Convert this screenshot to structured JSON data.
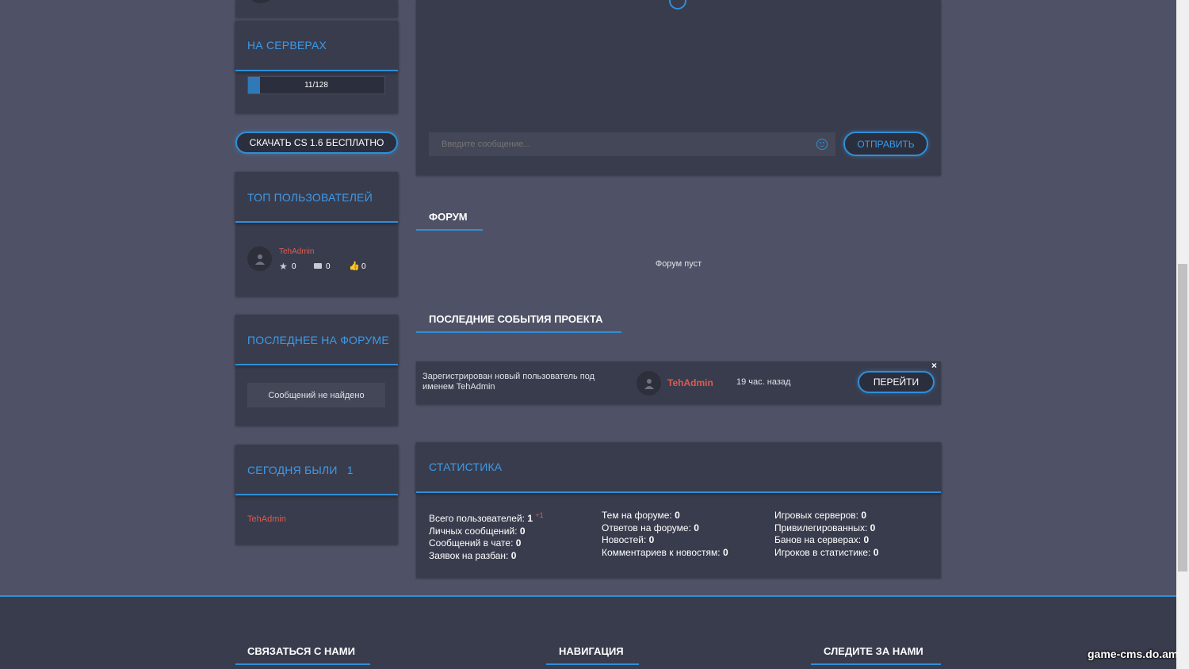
{
  "sidebar": {
    "servers": {
      "title": "На серверах",
      "online": "11/128",
      "progress": 0.086
    },
    "download_button": "Скачать CS 1.6 бесплатно",
    "top_users": {
      "title": "Топ пользователей",
      "user": {
        "name": "TehAdmin",
        "stars": "0",
        "messages": "0",
        "thanks": "0"
      }
    },
    "last_forum": {
      "title": "Последнее на форуме",
      "empty": "Сообщений не найдено"
    },
    "today": {
      "title": "Сегодня были",
      "count": "1",
      "user": "TehAdmin"
    }
  },
  "chat": {
    "placeholder": "Введите сообщение...",
    "send_button": "Отправить"
  },
  "forum": {
    "title": "Форум",
    "empty": "Форум пуст"
  },
  "events": {
    "title": "Последние события проекта",
    "item": {
      "text": "Зарегистрирован новый пользователь под именем TehAdmin",
      "user": "TehAdmin",
      "time": "19 час. назад",
      "button": "Перейти",
      "close": "×"
    }
  },
  "stats": {
    "title": "Статистика",
    "col1": [
      {
        "label": "Всего пользователей:",
        "value": "1",
        "badge": "+1"
      },
      {
        "label": "Личных сообщений:",
        "value": "0"
      },
      {
        "label": "Сообщений в чате:",
        "value": "0"
      },
      {
        "label": "Заявок на разбан:",
        "value": "0"
      }
    ],
    "col2": [
      {
        "label": "Тем на форуме:",
        "value": "0"
      },
      {
        "label": "Ответов на форуме:",
        "value": "0"
      },
      {
        "label": "Новостей:",
        "value": "0"
      },
      {
        "label": "Комментариев к новостям:",
        "value": "0"
      }
    ],
    "col3": [
      {
        "label": "Игровых серверов:",
        "value": "0"
      },
      {
        "label": "Привилегированных:",
        "value": "0"
      },
      {
        "label": "Банов на серверах:",
        "value": "0"
      },
      {
        "label": "Игроков в статистике:",
        "value": "0"
      }
    ]
  },
  "footer": {
    "contact": "Связаться с нами",
    "navigation": "Навигация",
    "follow": "Следите за нами",
    "watermark": "game-cms.do.am"
  },
  "colors": {
    "accent": "#2f8fd8",
    "user_name": "#e05a4f",
    "page_bg": "#4f5266",
    "panel_bg": "#393c4d"
  }
}
